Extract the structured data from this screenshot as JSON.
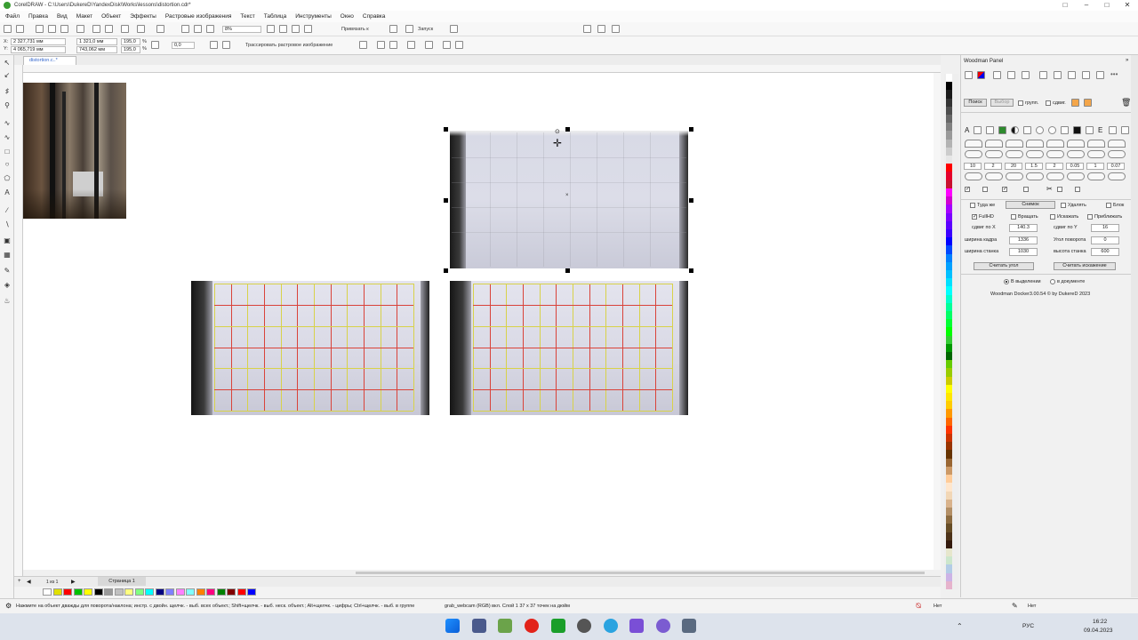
{
  "titlebar": {
    "title": "CorelDRAW - C:\\Users\\DukereD\\YandexDisk\\Works\\lessons\\distortion.cdr*"
  },
  "menu": [
    "Файл",
    "Правка",
    "Вид",
    "Макет",
    "Объект",
    "Эффекты",
    "Растровые изображения",
    "Текст",
    "Таблица",
    "Инструменты",
    "Окно",
    "Справка"
  ],
  "toolbar": {
    "zoom": "8%",
    "snap_label": "Привязать к",
    "launch_label": "Запуск"
  },
  "propbar": {
    "x": "2 327,731 мм",
    "y": "4 065,719 мм",
    "width": "1 321,0 мм",
    "height": "743,062 мм",
    "scale_x": "195,0",
    "scale_y": "195,0",
    "pct": "%",
    "rotation": "0,0",
    "trace_label": "Трассировать растровое изображение"
  },
  "document": {
    "tab_label": "distortion.c..*"
  },
  "pages": {
    "counter": "1 из 1",
    "page_tab": "Страница 1"
  },
  "status": {
    "hint": "Нажмите на объект дважды для поворота/наклона; инстр. с двойн. щелчк. - выб. всех объект.; Shift+щелчк. - выб. неск. объект.; Alt+щелчк. - цифры; Ctrl+щелчк. - выб. в группе",
    "object_info": "grab_webcam (RGB) вкл. Слой 1 37 x 37 точек на дюйм",
    "fill_none": "Нет",
    "outline_none": "Нет"
  },
  "docker": {
    "title": "Woodman Panel",
    "search_button": "Поиск",
    "select_button": "Выбор",
    "group_label": "групп.",
    "shift_label": "сдвиг.",
    "values_row": [
      "10",
      "2",
      "20",
      "1.5",
      "2",
      "0.05",
      "1",
      "0.07"
    ],
    "same_label": "Туда же",
    "snapshot_button": "Снимок",
    "delete_label": "Удалять",
    "block_label": "Блок",
    "fullhd_label": "FullHD",
    "rotate_label": "Вращать",
    "distort_label": "Искажать",
    "approx_label": "Приближать",
    "shift_x_label": "сдвиг по X",
    "shift_x": "140.3",
    "shift_y_label": "сдвиг по Y",
    "shift_y": "16",
    "frame_width_label": "ширина кадра",
    "frame_width": "1336",
    "rot_angle_label": "Угол поворота",
    "rot_angle": "0",
    "machine_width_label": "ширина станка",
    "machine_width": "1030",
    "machine_height_label": "высота станка",
    "machine_height": "600",
    "read_angle_button": "Считать угол",
    "read_distortion_button": "Считать искажение",
    "in_selection": "В выделении",
    "in_document": "в документе",
    "footer": "Woodman Docker3.00.54 © by DukereD 2023"
  },
  "taskbar": {
    "lang": "РУС",
    "time": "16:22",
    "date": "09.04.2023"
  },
  "colors": {
    "grid_red": "#d9433a",
    "grid_yellow": "#d8d24a",
    "selection": "#000000",
    "palette": [
      "#ffffff",
      "#000000",
      "#1a1a1a",
      "#333333",
      "#4d4d4d",
      "#666666",
      "#808080",
      "#999999",
      "#b3b3b3",
      "#cccccc",
      "#e6e6e6",
      "#ff0000",
      "#e4002b",
      "#c8102e",
      "#ff00ff",
      "#d100d1",
      "#a400ff",
      "#7a00ff",
      "#5b00ff",
      "#3a00ff",
      "#0000ff",
      "#0047ff",
      "#0080ff",
      "#00a0ff",
      "#00c0ff",
      "#00e0ff",
      "#00ffff",
      "#00ffcc",
      "#00ff99",
      "#00ff66",
      "#00ff33",
      "#00ff00",
      "#33cc33",
      "#009900",
      "#006600",
      "#66cc00",
      "#99cc00",
      "#cccc00",
      "#ffff00",
      "#ffe600",
      "#ffcc00",
      "#ff9900",
      "#ff6600",
      "#ff3300",
      "#cc3300",
      "#993300",
      "#663300",
      "#996633",
      "#cc9966",
      "#ffcc99",
      "#ffe6cc",
      "#f2d7b6",
      "#d9b38c",
      "#b38f66",
      "#8c6b40",
      "#664d26",
      "#4d3319",
      "#331a0d",
      "#e6e6cc",
      "#cce6cc",
      "#b3cce6",
      "#ccb3e6",
      "#e6b3cc"
    ]
  }
}
